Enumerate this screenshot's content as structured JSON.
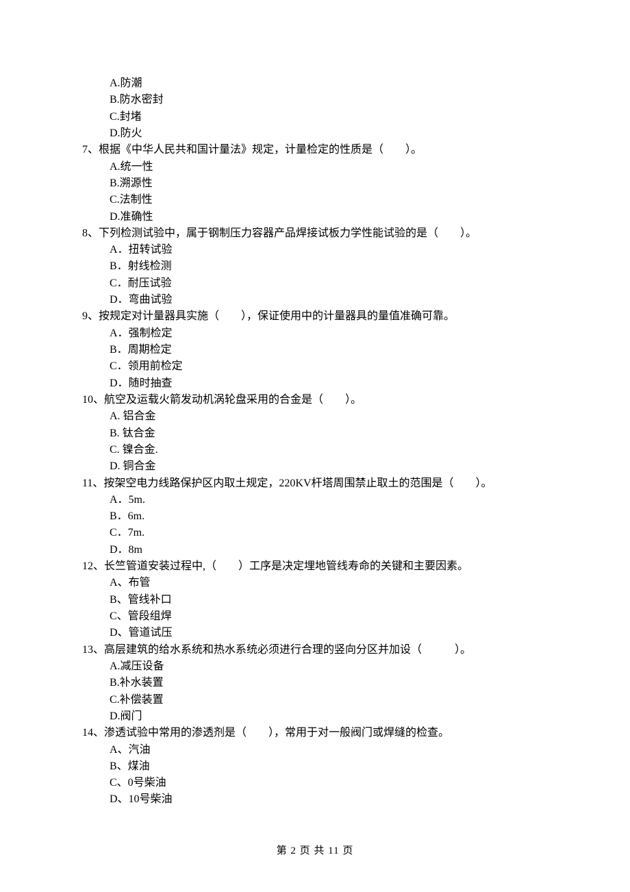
{
  "lines": {
    "q6a": "A.防潮",
    "q6b": "B.防水密封",
    "q6c": "C.封堵",
    "q6d": "D.防火",
    "q7": "7、根据《中华人民共和国计量法》规定，计量检定的性质是（　　）。",
    "q7a": "A.统一性",
    "q7b": "B.溯源性",
    "q7c": "C.法制性",
    "q7d": "D.准确性",
    "q8": "8、下列检测试验中，属于钢制压力容器产品焊接试板力学性能试验的是（　　）。",
    "q8a": "A．扭转试验",
    "q8b": "B．射线检测",
    "q8c": "C．耐压试验",
    "q8d": "D．弯曲试验",
    "q9": "9、按规定对计量器具实施（　　），保证使用中的计量器具的量值准确可靠。",
    "q9a": "A．强制检定",
    "q9b": "B．周期检定",
    "q9c": "C．领用前检定",
    "q9d": "D．随时抽查",
    "q10": "10、航空及运载火箭发动机涡轮盘采用的合金是（　　）。",
    "q10a": "A. 铝合金",
    "q10b": "B. 钛合金",
    "q10c": "C. 镍合金.",
    "q10d": "D. 铜合金",
    "q11": "11、按架空电力线路保护区内取土规定，220KV杆塔周围禁止取土的范围是（　　）。",
    "q11a": "A．5m.",
    "q11b": "B．6m.",
    "q11c": "C．7m.",
    "q11d": "D．8m",
    "q12": "12、长竺管道安装过程中,（　　）工序是决定埋地管线寿命的关键和主要因素。",
    "q12a": "A、布管",
    "q12b": "B、管线补口",
    "q12c": "C、管段组焊",
    "q12d": "D、管道试压",
    "q13": "13、高层建筑的给水系统和热水系统必须进行合理的竖向分区并加设（　　　）。",
    "q13a": "A.减压设备",
    "q13b": "B.补水装置",
    "q13c": "C.补偿装置",
    "q13d": "D.阀门",
    "q14": "14、渗透试验中常用的渗透剂是（　　），常用于对一般阀门或焊缝的检查。",
    "q14a": "A、汽油",
    "q14b": "B、煤油",
    "q14c": "C、0号柴油",
    "q14d": "D、10号柴油"
  },
  "footer": "第 2 页 共 11 页"
}
